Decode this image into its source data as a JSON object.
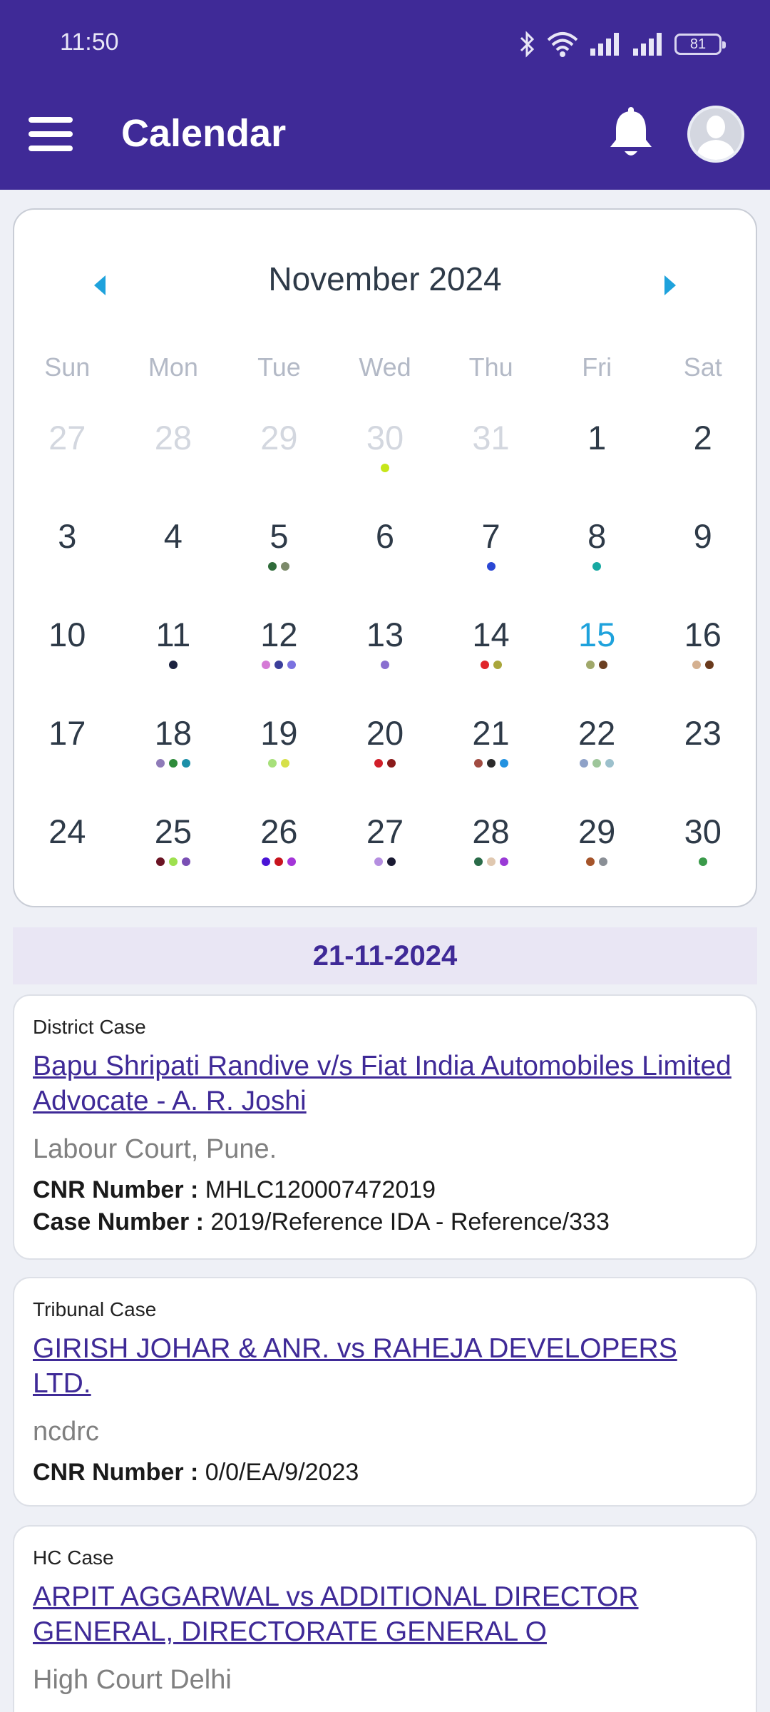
{
  "status_bar": {
    "time": "11:50",
    "battery": "81"
  },
  "app_bar": {
    "title": "Calendar"
  },
  "calendar": {
    "month_label": "November 2024",
    "weekdays": [
      "Sun",
      "Mon",
      "Tue",
      "Wed",
      "Thu",
      "Fri",
      "Sat"
    ],
    "days": [
      {
        "n": "27",
        "muted": true,
        "dots": []
      },
      {
        "n": "28",
        "muted": true,
        "dots": []
      },
      {
        "n": "29",
        "muted": true,
        "dots": []
      },
      {
        "n": "30",
        "muted": true,
        "dots": [
          "#c6e619"
        ]
      },
      {
        "n": "31",
        "muted": true,
        "dots": []
      },
      {
        "n": "1",
        "dots": []
      },
      {
        "n": "2",
        "dots": []
      },
      {
        "n": "3",
        "dots": []
      },
      {
        "n": "4",
        "dots": []
      },
      {
        "n": "5",
        "dots": [
          "#2f6b3a",
          "#7c8a6a"
        ]
      },
      {
        "n": "6",
        "dots": []
      },
      {
        "n": "7",
        "dots": [
          "#2a47d4"
        ]
      },
      {
        "n": "8",
        "dots": [
          "#17a9a2"
        ]
      },
      {
        "n": "9",
        "dots": []
      },
      {
        "n": "10",
        "dots": []
      },
      {
        "n": "11",
        "dots": [
          "#1c2340"
        ]
      },
      {
        "n": "12",
        "dots": [
          "#d57ad6",
          "#3b3e9a",
          "#7b72e0"
        ]
      },
      {
        "n": "13",
        "dots": [
          "#8a6fd0"
        ]
      },
      {
        "n": "14",
        "dots": [
          "#e0262b",
          "#a9a63b"
        ]
      },
      {
        "n": "15",
        "today": true,
        "dots": [
          "#a0a86a",
          "#6b3f22"
        ]
      },
      {
        "n": "16",
        "dots": [
          "#d4b090",
          "#6a3a1c"
        ]
      },
      {
        "n": "17",
        "dots": []
      },
      {
        "n": "18",
        "dots": [
          "#8f7bb8",
          "#2e8b3a",
          "#1c8fa8"
        ]
      },
      {
        "n": "19",
        "dots": [
          "#a7e07a",
          "#d6e04a"
        ]
      },
      {
        "n": "20",
        "dots": [
          "#d11f2a",
          "#8a1a1a"
        ]
      },
      {
        "n": "21",
        "dots": [
          "#a14c42",
          "#2b2b2b",
          "#2392e0"
        ]
      },
      {
        "n": "22",
        "dots": [
          "#8fa2c8",
          "#9ec69a",
          "#9cc0cc"
        ]
      },
      {
        "n": "23",
        "dots": []
      },
      {
        "n": "24",
        "dots": []
      },
      {
        "n": "25",
        "dots": [
          "#6b1424",
          "#9ee04f",
          "#7a4fb4"
        ]
      },
      {
        "n": "26",
        "dots": [
          "#4a14d6",
          "#c8141e",
          "#a435d8"
        ]
      },
      {
        "n": "27",
        "dots": [
          "#b58ee0",
          "#1a1a33"
        ]
      },
      {
        "n": "28",
        "dots": [
          "#2a6b48",
          "#e0c8b0",
          "#9a3ad6"
        ]
      },
      {
        "n": "29",
        "dots": [
          "#a5542a",
          "#8a8f96"
        ]
      },
      {
        "n": "30",
        "dots": [
          "#3a9a4a"
        ]
      }
    ]
  },
  "selected_date": "21-11-2024",
  "cases": [
    {
      "type": "District Case",
      "title": "Bapu Shripati Randive v/s Fiat  India Automobiles Limited   Advocate - A. R. Joshi",
      "court": "Labour Court, Pune.",
      "cnr_label": "CNR Number : ",
      "cnr": "MHLC120007472019",
      "case_label": "Case Number : ",
      "case_no": "2019/Reference IDA - Reference/333"
    },
    {
      "type": "Tribunal Case",
      "title": "GIRISH JOHAR & ANR. vs RAHEJA DEVELOPERS LTD.",
      "court": "ncdrc",
      "cnr_label": "CNR Number : ",
      "cnr": "0/0/EA/9/2023"
    },
    {
      "type": "HC Case",
      "title": "ARPIT AGGARWAL vs ADDITIONAL DIRECTOR GENERAL, DIRECTORATE GENERAL O",
      "court": "High Court Delhi"
    }
  ]
}
